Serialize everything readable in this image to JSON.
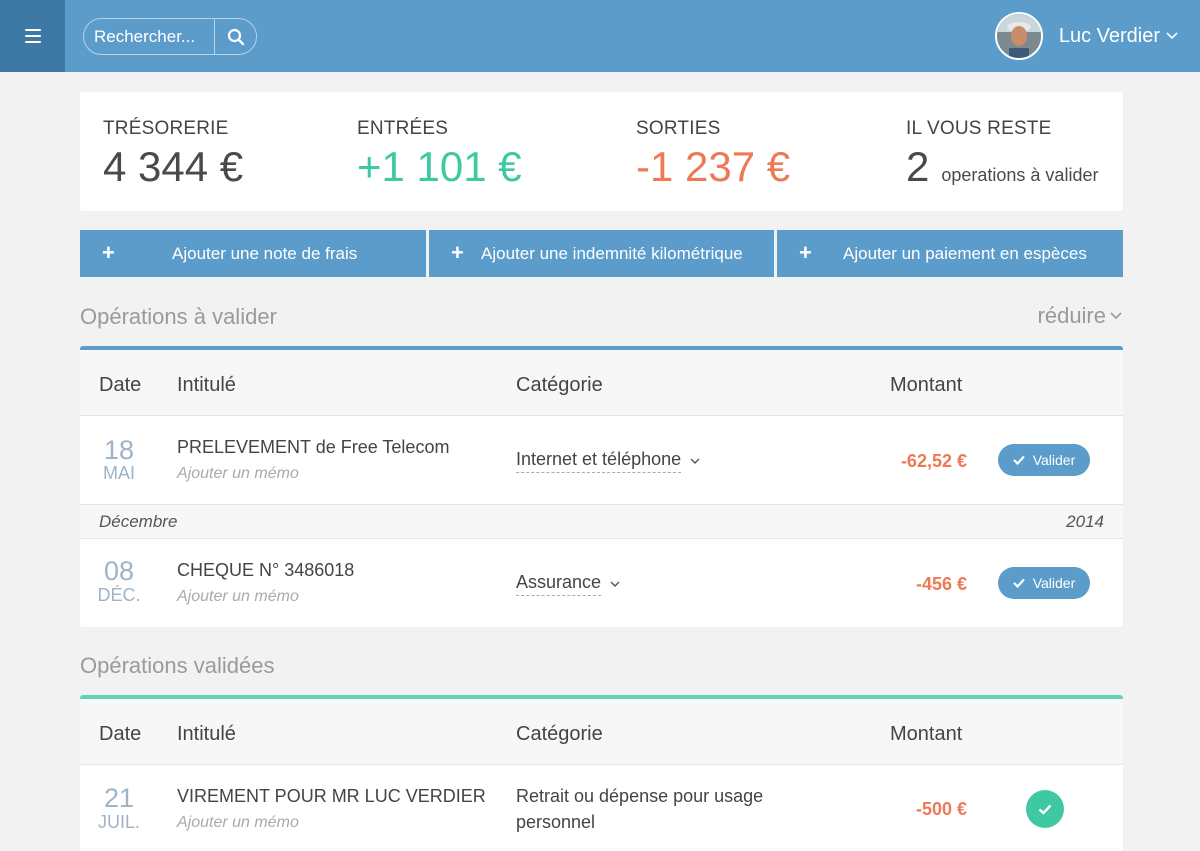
{
  "header": {
    "search_placeholder": "Rechercher...",
    "user_name": "Luc Verdier"
  },
  "stats": {
    "tresorerie": {
      "label": "TRÉSORERIE",
      "value": "4 344 €"
    },
    "entrees": {
      "label": "ENTRÉES",
      "value": "+1 101 €"
    },
    "sorties": {
      "label": "SORTIES",
      "value": "-1 237 €"
    },
    "reste": {
      "label": "IL VOUS RESTE",
      "count": "2",
      "text": "operations à valider"
    }
  },
  "actions": {
    "note_frais": "Ajouter une note de frais",
    "indemnite": "Ajouter une indemnité kilométrique",
    "especes": "Ajouter un paiement en espèces"
  },
  "pending": {
    "title": "Opérations à valider",
    "collapse_label": "réduire",
    "columns": {
      "date": "Date",
      "intitule": "Intitulé",
      "categorie": "Catégorie",
      "montant": "Montant"
    },
    "rows": [
      {
        "day": "18",
        "month": "MAI",
        "label": "PRELEVEMENT de Free Telecom",
        "memo": "Ajouter un mémo",
        "category": "Internet et téléphone",
        "amount": "-62,52 €",
        "button": "Valider"
      },
      {
        "day": "08",
        "month": "DÉC.",
        "label": "CHEQUE N° 3486018",
        "memo": "Ajouter un mémo",
        "category": "Assurance",
        "amount": "-456 €",
        "button": "Valider"
      }
    ],
    "group": {
      "month": "Décembre",
      "year": "2014"
    }
  },
  "validated": {
    "title": "Opérations validées",
    "columns": {
      "date": "Date",
      "intitule": "Intitulé",
      "categorie": "Catégorie",
      "montant": "Montant"
    },
    "rows": [
      {
        "day": "21",
        "month": "JUIL.",
        "label": "VIREMENT POUR MR LUC VERDIER",
        "memo": "Ajouter un mémo",
        "category": "Retrait ou dépense pour usage personnel",
        "amount": "-500 €"
      }
    ]
  },
  "colors": {
    "primary": "#5b9ccb",
    "primary_dark": "#3e79a6",
    "green": "#3ec9a2",
    "red": "#ee7a55"
  }
}
